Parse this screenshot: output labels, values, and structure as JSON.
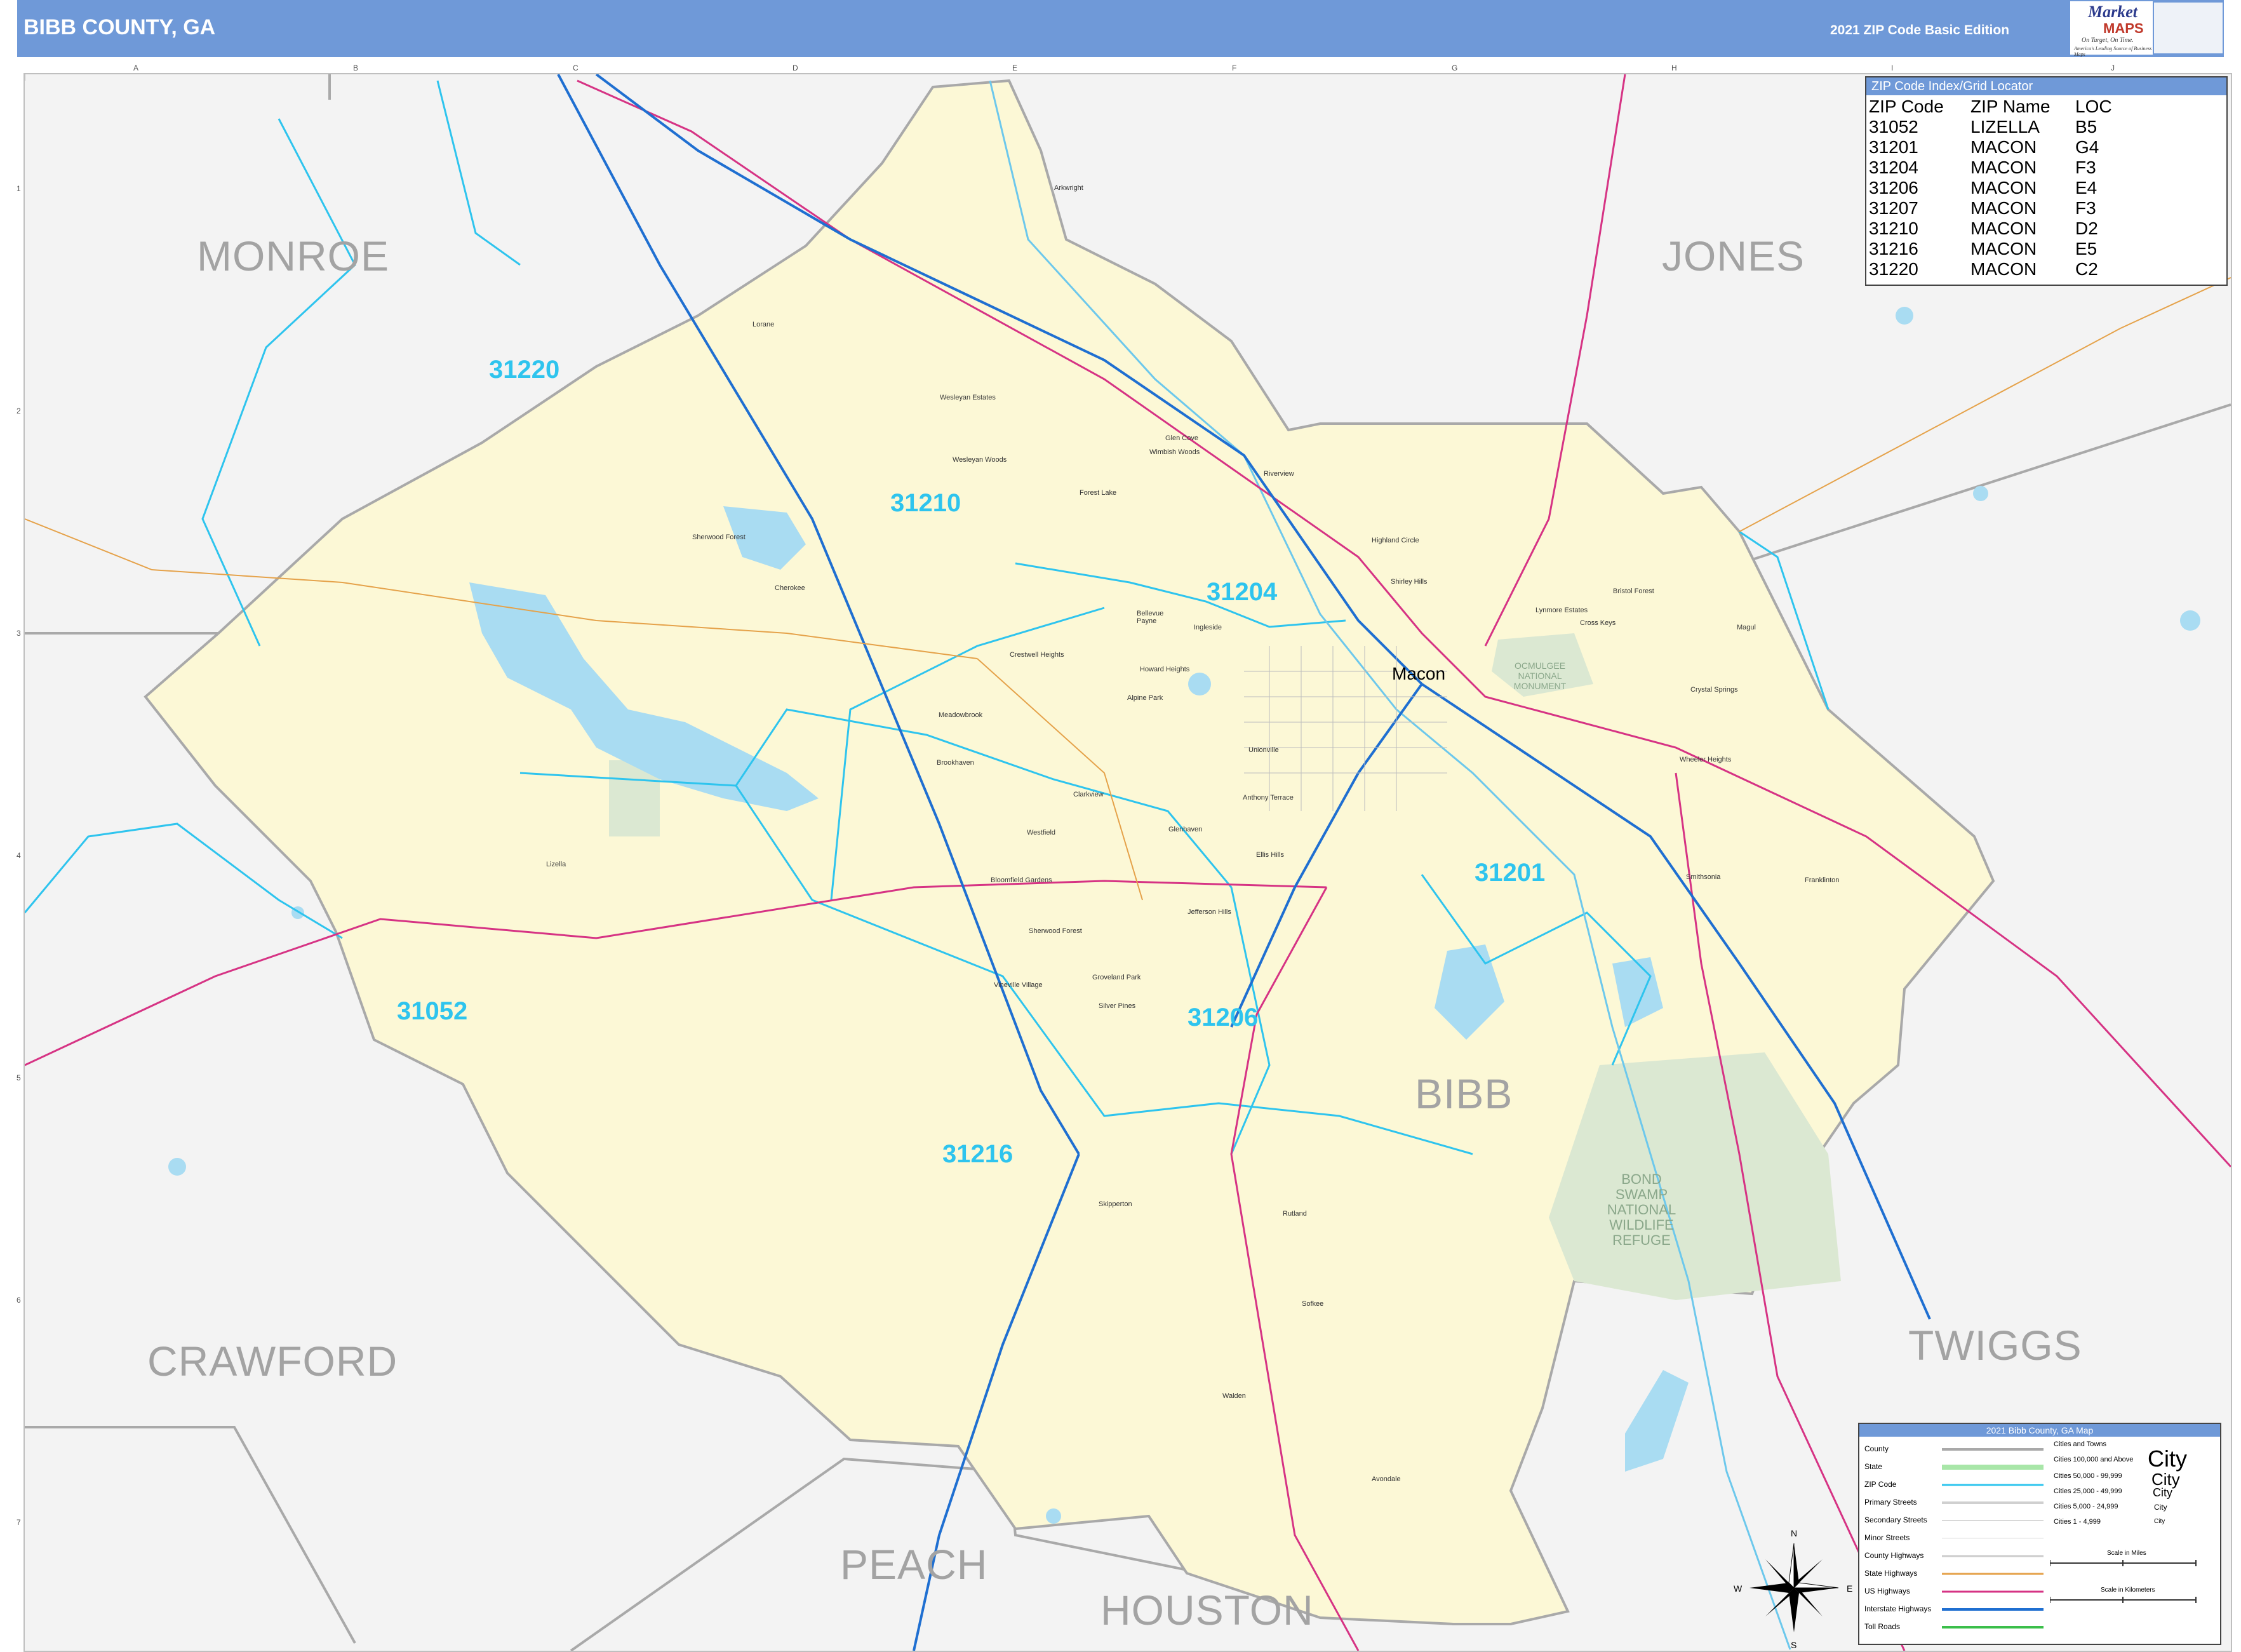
{
  "header": {
    "title": "BIBB COUNTY, GA",
    "edition": "2021 ZIP Code Basic Edition"
  },
  "logo": {
    "brand_line1": "Market",
    "brand_line2": "MAPS",
    "slogan": "On Target, On Time.",
    "subslogan": "America's Leading Source of Business Maps"
  },
  "colors": {
    "header_bg": "#6f99d8",
    "county_fill": "#fcf8d6",
    "outside_fill": "#f3f3f3",
    "zip_boundary": "#2ec4ee",
    "water": "#a9dcf2",
    "park": "#dbe8d2",
    "interstate": "#1f6fd1",
    "us_highway": "#d63384",
    "state_highway": "#e5a24a"
  },
  "grid": {
    "columns": [
      "A",
      "B",
      "C",
      "D",
      "E",
      "F",
      "G",
      "H",
      "I",
      "J"
    ],
    "rows": [
      "1",
      "2",
      "3",
      "4",
      "5",
      "6",
      "7"
    ]
  },
  "counties": {
    "monroe": "MONROE",
    "jones": "JONES",
    "crawford": "CRAWFORD",
    "twiggs": "TWIGGS",
    "bibb": "BIBB",
    "peach": "PEACH",
    "houston": "HOUSTON"
  },
  "zip_labels": {
    "z31220": "31220",
    "z31210": "31210",
    "z31204": "31204",
    "z31201": "31201",
    "z31052": "31052",
    "z31206": "31206",
    "z31216": "31216"
  },
  "city": {
    "macon": "Macon"
  },
  "parks": {
    "ocmulgee": "OCMULGEE NATIONAL MONUMENT",
    "bond_swamp": "BOND SWAMP NATIONAL WILDLIFE REFUGE"
  },
  "places": {
    "arkwright": "Arkwright",
    "lorane": "Lorane",
    "wesleyan_estates": "Wesleyan Estates",
    "glen_cove": "Glen Cove",
    "wimbish_woods": "Wimbish Woods",
    "wesleyan_woods": "Wesleyan Woods",
    "forest_lake": "Forest Lake",
    "riverview": "Riverview",
    "sherwood_forest_n": "Sherwood Forest",
    "cherokee": "Cherokee",
    "highland_circle": "Highland Circle",
    "shirley_hills": "Shirley Hills",
    "ingleside": "Ingleside",
    "bellevue": "Bellevue Payne",
    "crestwell": "Crestwell Heights",
    "howard": "Howard Heights",
    "alpine_park": "Alpine Park",
    "meadowbrook": "Meadowbrook",
    "unionville": "Unionville",
    "bristol_forest": "Bristol Forest",
    "lynmore": "Lynmore Estates",
    "cross_keys": "Cross Keys",
    "magul": "Magul",
    "crystal_springs": "Crystal Springs",
    "wheeler_heights": "Wheeler Heights",
    "brookhaven": "Brookhaven",
    "clarkview": "Clarkview",
    "anthony_terrace": "Anthony Terrace",
    "glenhaven": "Glenhaven",
    "westfield": "Westfield",
    "bloomfield": "Bloomfield Gardens",
    "jefferson_hills": "Jefferson Hills",
    "sherwood_forest_s": "Sherwood Forest",
    "lizella": "Lizella",
    "smithsonia": "Smithsonia",
    "franklinton": "Franklinton",
    "groveland": "Groveland Park",
    "silver_pines": "Silver Pines",
    "vineville": "Vineville Village",
    "skipperton": "Skipperton",
    "rutland": "Rutland",
    "sofkee": "Sofkee",
    "walden": "Walden",
    "avondale": "Avondale",
    "ellis_hills": "Ellis Hills"
  },
  "zip_index": {
    "header": "ZIP Code Index/Grid Locator",
    "columns": [
      "ZIP Code",
      "ZIP Name",
      "LOC"
    ],
    "rows": [
      [
        "31052",
        "LIZELLA",
        "B5"
      ],
      [
        "31201",
        "MACON",
        "G4"
      ],
      [
        "31204",
        "MACON",
        "F3"
      ],
      [
        "31206",
        "MACON",
        "E4"
      ],
      [
        "31207",
        "MACON",
        "F3"
      ],
      [
        "31210",
        "MACON",
        "D2"
      ],
      [
        "31216",
        "MACON",
        "E5"
      ],
      [
        "31220",
        "MACON",
        "C2"
      ]
    ]
  },
  "legend": {
    "header": "2021 Bibb County, GA Map",
    "items": [
      "County",
      "State",
      "ZIP Code",
      "Primary Streets",
      "Secondary Streets",
      "Minor Streets",
      "County Highways",
      "State Highways",
      "US Highways",
      "Interstate Highways",
      "Toll Roads"
    ],
    "cities_title": "Cities and Towns",
    "city_classes": [
      "Cities 100,000 and Above",
      "Cities 50,000 - 99,999",
      "Cities 25,000 - 49,999",
      "Cities 5,000 - 24,999",
      "Cities 1 - 4,999"
    ],
    "city_sample": "City",
    "scale_miles": "Scale in Miles",
    "scale_km": "Scale in Kilometers"
  },
  "compass": {
    "n": "N",
    "s": "S",
    "e": "E",
    "w": "W"
  }
}
